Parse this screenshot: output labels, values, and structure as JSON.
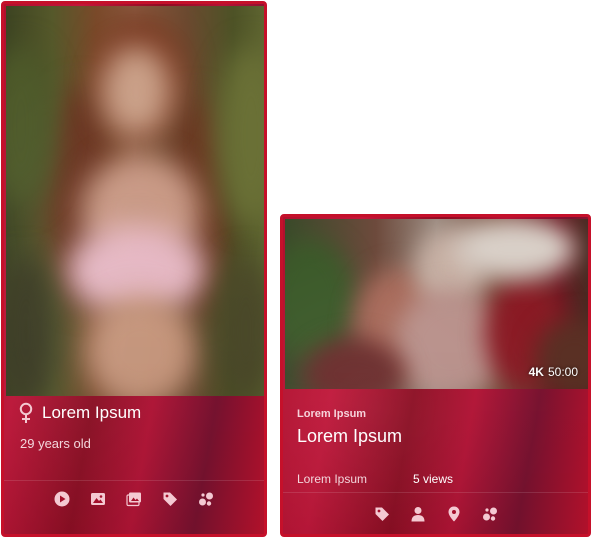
{
  "performer_card": {
    "name": "Lorem Ipsum",
    "age": "29 years old",
    "icons": [
      "play-circle-icon",
      "image-icon",
      "images-icon",
      "tag-icon",
      "gallery-dots-icon"
    ],
    "gender_icon": "female-icon"
  },
  "scene_card": {
    "resolution": "4K",
    "duration": "50:00",
    "studio": "Lorem Ipsum",
    "title": "Lorem Ipsum",
    "date": "Lorem Ipsum",
    "views": "5 views",
    "icons": [
      "tag-icon",
      "person-icon",
      "location-pin-icon",
      "gallery-dots-icon"
    ]
  },
  "colors": {
    "card_border": "#c5102a",
    "card_background": "#b0102e",
    "icon": "#f4c9d2"
  }
}
